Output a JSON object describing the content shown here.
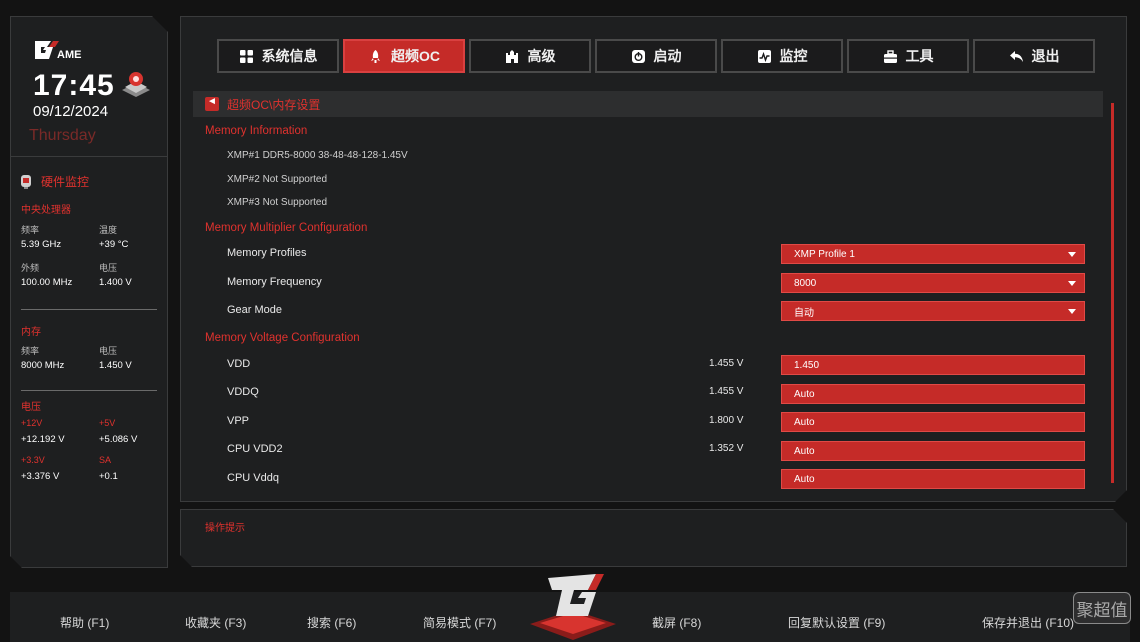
{
  "header": {
    "time": "17:45",
    "date": "09/12/2024",
    "weekday": "Thursday"
  },
  "monitor": {
    "title": "硬件监控",
    "cpu": {
      "title": "中央处理器",
      "freq_label": "频率",
      "freq_value": "5.39 GHz",
      "temp_label": "温度",
      "temp_value": "+39 °C",
      "bclk_label": "外频",
      "bclk_value": "100.00 MHz",
      "volt_label": "电压",
      "volt_value": "1.400 V"
    },
    "memory": {
      "title": "内存",
      "freq_label": "频率",
      "freq_value": "8000 MHz",
      "volt_label": "电压",
      "volt_value": "1.450 V"
    },
    "voltage": {
      "title": "电压",
      "v12_label": "+12V",
      "v12_value": "+12.192 V",
      "v5_label": "+5V",
      "v5_value": "+5.086 V",
      "v33_label": "+3.3V",
      "v33_value": "+3.376 V",
      "sa_label": "SA",
      "sa_value": "+0.1"
    }
  },
  "tabs": [
    {
      "label": "系统信息",
      "icon": "grid-icon"
    },
    {
      "label": "超频OC",
      "icon": "rocket-icon",
      "active": true
    },
    {
      "label": "高级",
      "icon": "castle-icon"
    },
    {
      "label": "启动",
      "icon": "power-icon"
    },
    {
      "label": "监控",
      "icon": "chart-icon"
    },
    {
      "label": "工具",
      "icon": "toolbox-icon"
    },
    {
      "label": "退出",
      "icon": "return-icon"
    }
  ],
  "breadcrumb": "超频OC\\内存设置",
  "memory_info": {
    "title": "Memory Information",
    "xmp1": "XMP#1 DDR5-8000 38-48-48-128-1.45V",
    "xmp2": "XMP#2 Not Supported",
    "xmp3": "XMP#3 Not Supported"
  },
  "multiplier": {
    "title": "Memory Multiplier Configuration",
    "profiles_label": "Memory Profiles",
    "profiles_value": "XMP Profile 1",
    "frequency_label": "Memory Frequency",
    "frequency_value": "8000",
    "gear_label": "Gear Mode",
    "gear_value": "自动"
  },
  "voltage_cfg": {
    "title": "Memory Voltage Configuration",
    "vdd_label": "VDD",
    "vdd_current": "1.455 V",
    "vdd_value": "1.450",
    "vddq_label": "VDDQ",
    "vddq_current": "1.455 V",
    "vddq_value": "Auto",
    "vpp_label": "VPP",
    "vpp_current": "1.800 V",
    "vpp_value": "Auto",
    "cpuvdd2_label": "CPU VDD2",
    "cpuvdd2_current": "1.352 V",
    "cpuvdd2_value": "Auto",
    "cpuvddq_label": "CPU Vddq",
    "cpuvddq_value": "Auto"
  },
  "help": {
    "title": "操作提示"
  },
  "footer": {
    "help": "帮助 (F1)",
    "favorites": "收藏夹 (F3)",
    "search": "搜索 (F6)",
    "easy_mode": "简易模式 (F7)",
    "screenshot": "截屏 (F8)",
    "defaults": "回复默认设置 (F9)",
    "save_exit": "保存并退出 (F10)"
  },
  "watermark": "聚超值",
  "colors": {
    "accent": "#c52b28",
    "panel": "#1e1f20",
    "background": "#131313"
  }
}
